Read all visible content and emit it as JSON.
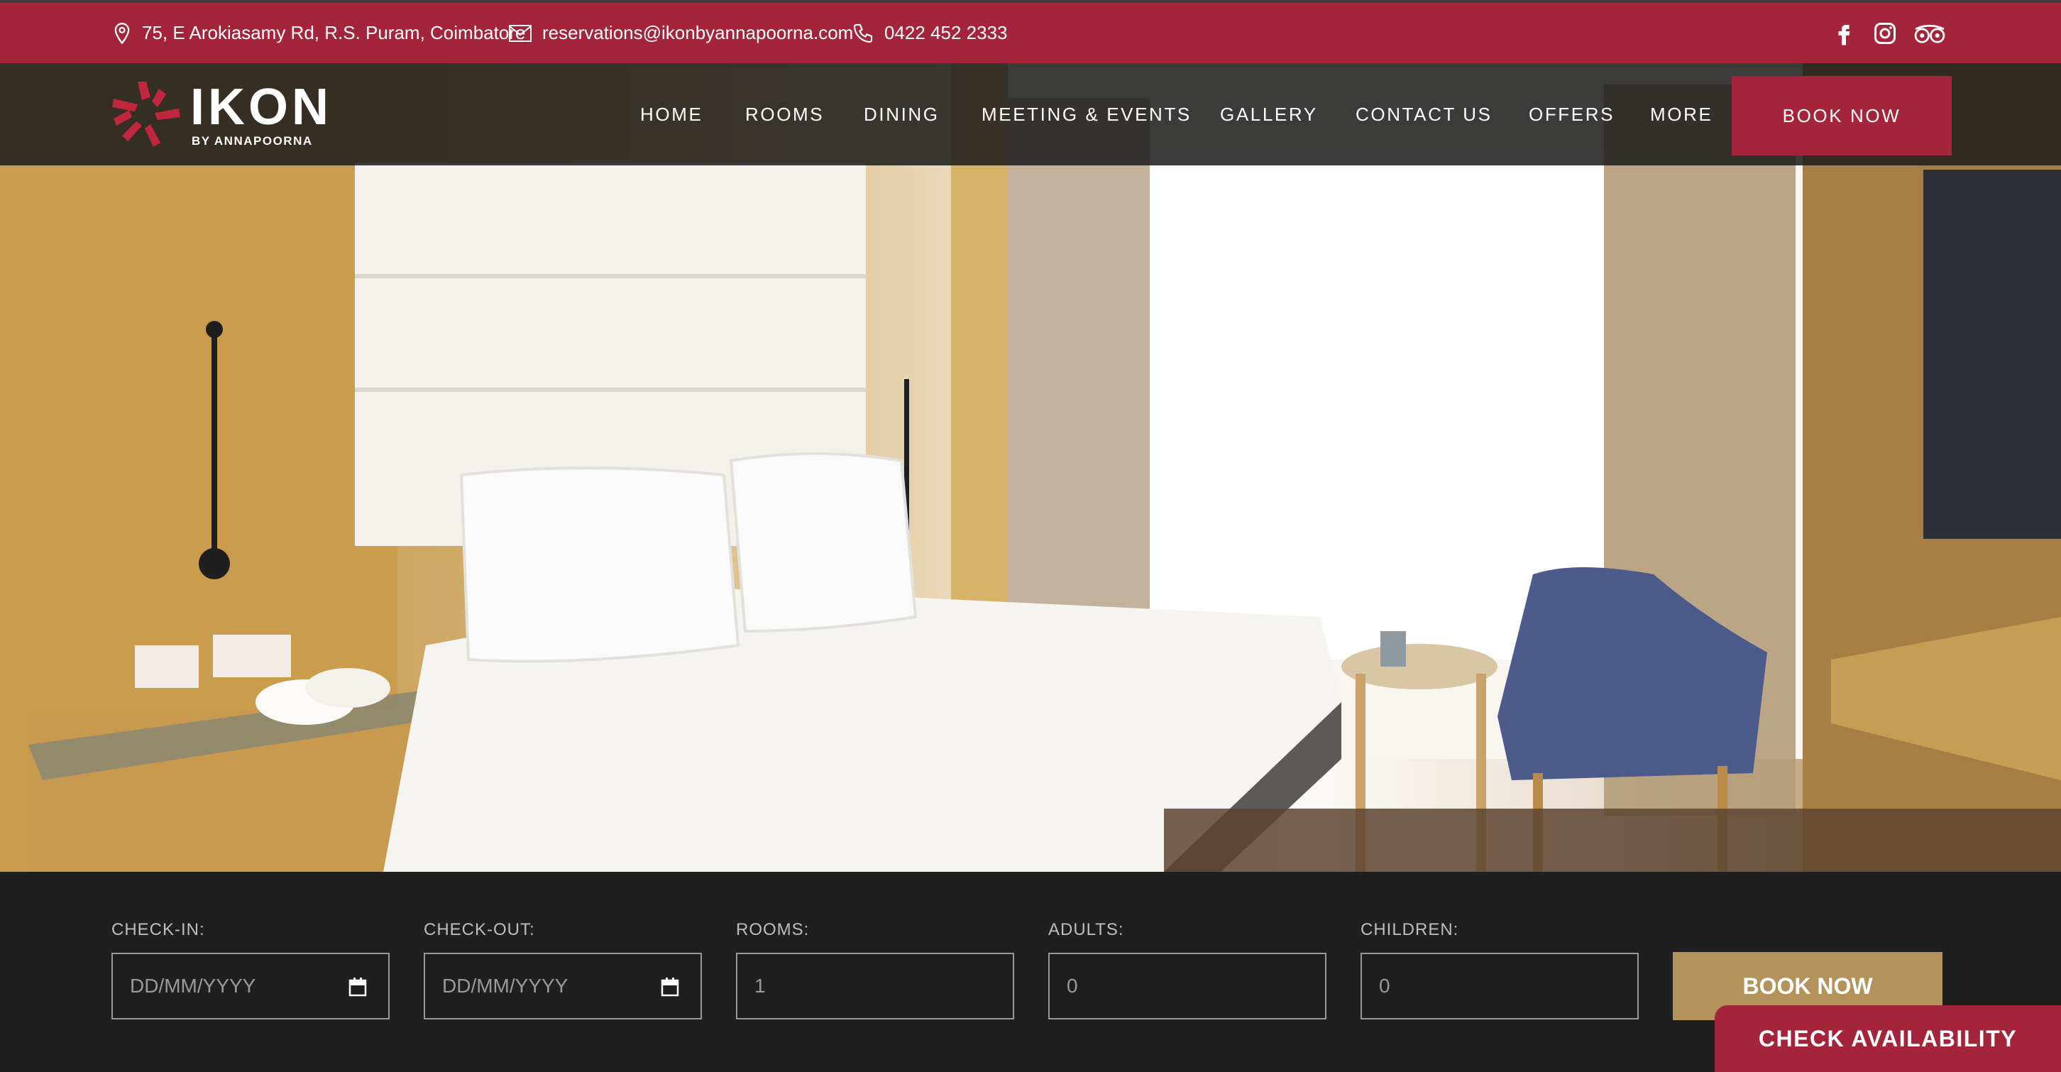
{
  "topbar": {
    "address": "75, E Arokiasamy Rd, R.S. Puram, Coimbatore",
    "email": "reservations@ikonbyannapoorna.com",
    "phone": "0422 452 2333",
    "icons": [
      "location-pin-icon",
      "envelope-icon",
      "phone-icon",
      "facebook-icon",
      "instagram-icon",
      "tripadvisor-icon"
    ]
  },
  "brand": {
    "name": "IKON",
    "tagline": "BY ANNAPOORNA"
  },
  "nav": {
    "items": [
      "HOME",
      "ROOMS",
      "DINING",
      "MEETING & EVENTS",
      "GALLERY",
      "CONTACT US",
      "OFFERS",
      "MORE"
    ],
    "book_label": "BOOK NOW"
  },
  "booking": {
    "checkin": {
      "label": "CHECK-IN:",
      "placeholder": "DD/MM/YYYY"
    },
    "checkout": {
      "label": "CHECK-OUT:",
      "placeholder": "DD/MM/YYYY"
    },
    "rooms": {
      "label": "ROOMS:",
      "value": "1"
    },
    "adults": {
      "label": "ADULTS:",
      "value": "0"
    },
    "children": {
      "label": "CHILDREN:",
      "value": "0"
    },
    "submit_label": "BOOK NOW"
  },
  "floating": {
    "check_availability": "CHECK AVAILABILITY"
  },
  "colors": {
    "brand_red": "#a3243b",
    "gold": "#b3935a",
    "dark": "#1f1f1f"
  }
}
